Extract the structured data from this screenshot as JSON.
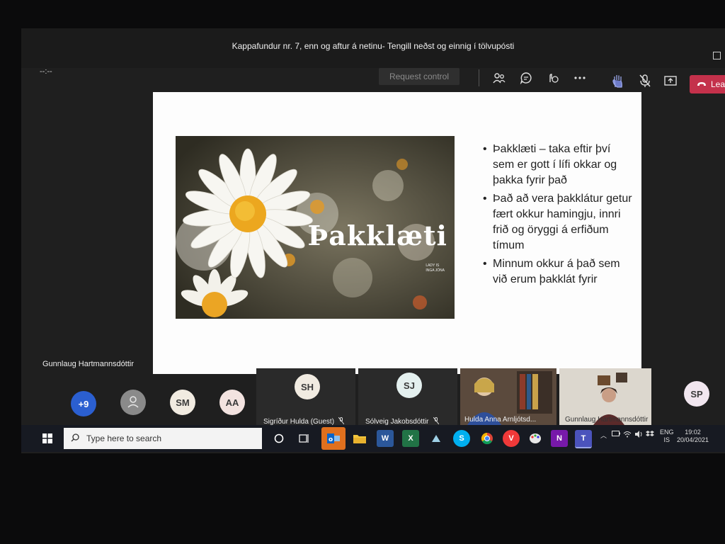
{
  "window": {
    "title": "Kappafundur nr. 7, enn og aftur á netinu- Tengill neðst og einnig í tölvupósti"
  },
  "toolbar": {
    "timer": "--:--",
    "request_control_label": "Request control",
    "leave_label": "Lea"
  },
  "slide": {
    "photo_title": "Þakklæti",
    "photo_credit_line1": "LADY IS",
    "photo_credit_line2": "INGA JÓNA",
    "bullets": [
      "Þakklæti – taka eftir því sem er gott í lífi okkar og þakka fyrir það",
      "Það að vera þakklátur getur fært okkur hamingju, innri frið og öryggi á erfiðum tímum",
      "Minnum okkur á það sem við erum þakklát fyrir"
    ]
  },
  "presenter_name": "Gunnlaug Hartmannsdóttir",
  "participants": {
    "overflow": "+9",
    "avatars": [
      "SM",
      "AA"
    ],
    "tiles": [
      {
        "initials": "SH",
        "name": "Sigríður Hulda (Guest)"
      },
      {
        "initials": "SJ",
        "name": "Sólveig Jakobsdóttir"
      }
    ],
    "video_tiles": [
      {
        "name": "Hulda Anna Arnljótsd..."
      },
      {
        "name": "Gunnlaug Hartmannsdóttir"
      }
    ],
    "extra_avatar": "SP"
  },
  "taskbar": {
    "search_placeholder": "Type here to search",
    "apps": [
      "outlook",
      "file-explorer",
      "word",
      "excel",
      "app",
      "skype",
      "chrome",
      "vivaldi",
      "paint",
      "onenote",
      "teams"
    ],
    "language_line1": "ENG",
    "language_line2": "IS",
    "time": "19:02",
    "date": "20/04/2021"
  },
  "colors": {
    "leave_red": "#c4314b",
    "teams_bg": "#1f1f1f",
    "overflow_blue": "#2b5fd0"
  }
}
